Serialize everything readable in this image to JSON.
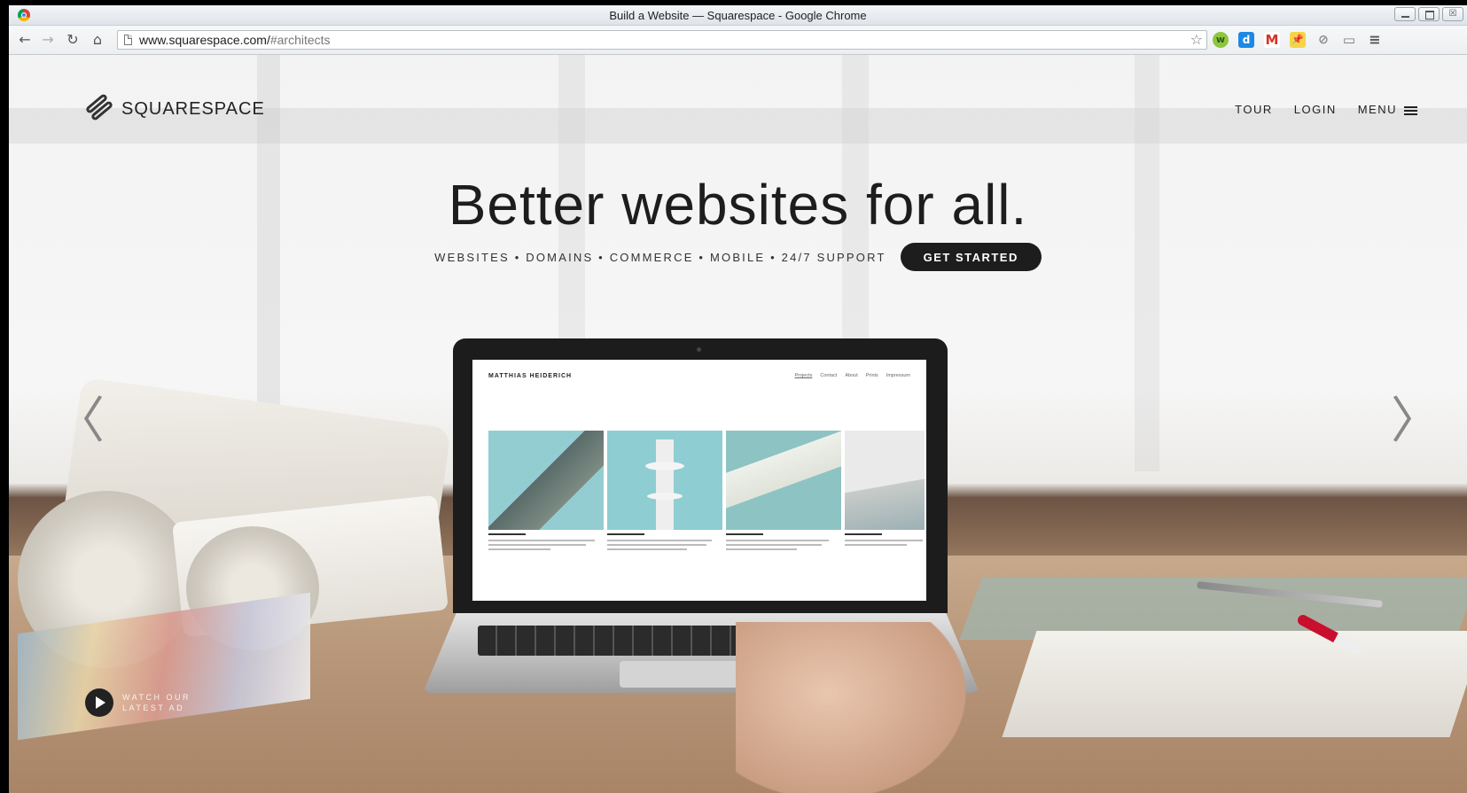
{
  "window": {
    "title": "Build a Website — Squarespace - Google Chrome",
    "controls": {
      "close_glyph": "☒"
    }
  },
  "browser": {
    "url_host": "www.squarespace.com/",
    "url_path": "#architects",
    "nav": {
      "back": "←",
      "forward": "→",
      "reload": "↻",
      "home": "⌂"
    },
    "star_glyph": "☆",
    "extensions": [
      {
        "name": "w-extension-icon",
        "glyph": "w"
      },
      {
        "name": "d-extension-icon",
        "glyph": "d"
      },
      {
        "name": "gmail-icon",
        "glyph": "M"
      },
      {
        "name": "pin-extension-icon",
        "glyph": "📌"
      },
      {
        "name": "tool-extension-icon",
        "glyph": "⊘"
      },
      {
        "name": "cast-icon",
        "glyph": "▭"
      },
      {
        "name": "chrome-menu-icon",
        "glyph": "≡"
      }
    ]
  },
  "site": {
    "logo_text": "SQUARESPACE",
    "nav": {
      "tour": "TOUR",
      "login": "LOGIN",
      "menu": "MENU"
    },
    "headline": "Better websites for all.",
    "tagline": "WEBSITES • DOMAINS • COMMERCE • MOBILE • 24/7 SUPPORT",
    "cta": "GET STARTED",
    "arrows": {
      "prev": "〈",
      "next": "〉"
    },
    "watch_ad": "WATCH OUR LATEST AD"
  },
  "laptop_screen": {
    "brand": "MATTHIAS HEIDERICH",
    "nav": [
      "Projects",
      "Contact",
      "About",
      "Prints",
      "Impressum"
    ]
  },
  "colors": {
    "cta_bg": "#1d1d1d",
    "text_dark": "#222222"
  }
}
